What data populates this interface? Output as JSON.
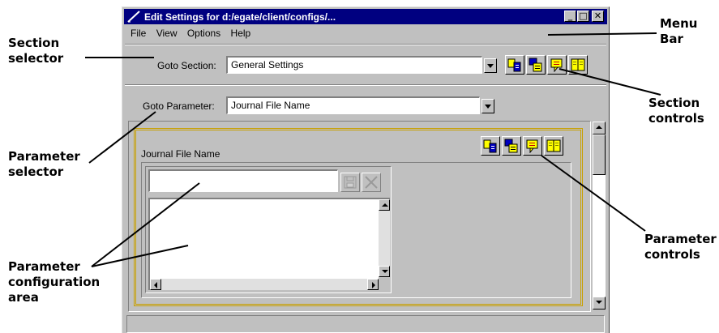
{
  "window": {
    "title": "Edit Settings for d:/egate/client/configs/...",
    "controls": {
      "minimize": "_",
      "maximize": "□",
      "close": "✕"
    }
  },
  "menu": {
    "items": [
      "File",
      "View",
      "Options",
      "Help"
    ]
  },
  "section": {
    "label": "Goto Section:",
    "value": "General Settings",
    "controls": [
      "copy-icon",
      "paste-icon",
      "comment-icon",
      "help-book-icon"
    ]
  },
  "parameter": {
    "label": "Goto Parameter:",
    "value": "Journal File Name",
    "panel_title": "Journal File Name",
    "controls": [
      "copy-icon",
      "paste-icon",
      "comment-icon",
      "help-book-icon"
    ],
    "input_value": "",
    "input_buttons": [
      "save-icon",
      "delete-icon"
    ]
  },
  "callouts": {
    "section_selector": [
      "Section",
      "selector"
    ],
    "menu_bar": [
      "Menu",
      "Bar"
    ],
    "section_controls": [
      "Section",
      "controls"
    ],
    "parameter_selector": [
      "Parameter",
      "selector"
    ],
    "parameter_controls": [
      "Parameter",
      "controls"
    ],
    "parameter_config_area": [
      "Parameter",
      "configuration",
      "area"
    ]
  },
  "colors": {
    "titlebar": "#000080",
    "window_face": "#c0c0c0",
    "panel_border": "#c8a000",
    "icon_yellow": "#ffff00"
  }
}
